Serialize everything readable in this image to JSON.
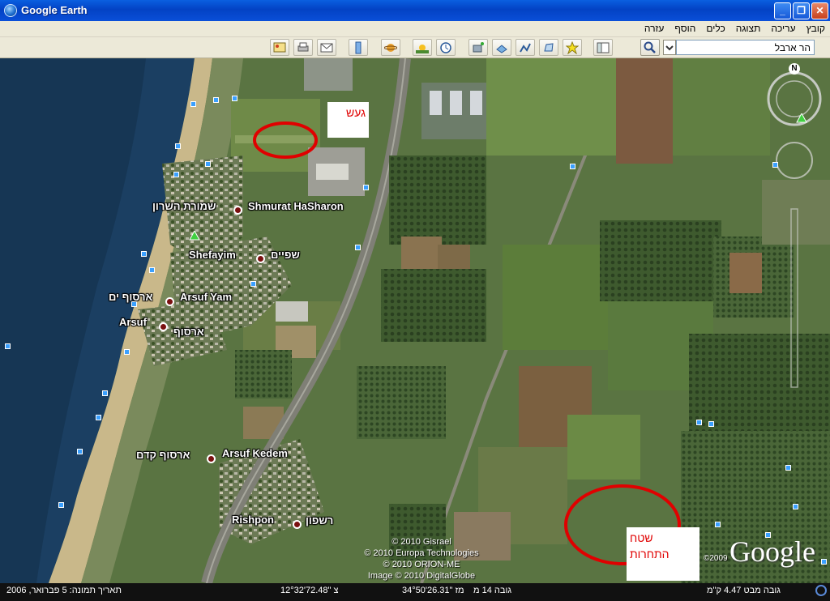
{
  "window": {
    "title": "Google Earth"
  },
  "menu": {
    "items": [
      "קובץ",
      "עריכה",
      "תצוגה",
      "כלים",
      "הוסף",
      "עזרה"
    ]
  },
  "search": {
    "value": "הר ארבל"
  },
  "places": {
    "shmurat_he": "שמורת השרון",
    "shmurat_en": "Shmurat HaSharon",
    "shefayim_en": "Shefayim",
    "shefayim_he": "שפיים",
    "arsufyam_he": "ארסוף ים",
    "arsufyam_en": "Arsuf Yam",
    "arsuf_en": "Arsuf",
    "arsuf_he": "ארסוף",
    "arsufkedem_he": "ארסוף קדם",
    "arsufkedem_en": "Arsuf Kedem",
    "rishpon_en": "Rishpon",
    "rishpon_he": "רשפון"
  },
  "annotations": {
    "top": "געש",
    "bottom_line1": "שטח",
    "bottom_line2": "התחרות"
  },
  "attribution": {
    "line1": "© 2010 Gisrael",
    "line2": "© 2010 Europa Technologies",
    "line3": "© 2010 ORION-ME",
    "line4": "Image © 2010 DigitalGlobe"
  },
  "brand": {
    "name": "Google",
    "year": "©2009"
  },
  "status": {
    "date": "תאריך תמונה: 5 פברואר, 2006",
    "lat": "12°32'72.48\" צ",
    "lon": "34°50'26.31\" מז",
    "elev": "גובה  14 מ",
    "eye": "גובה מבט  4.47 ק\"מ"
  },
  "colors": {
    "sea": "#1b3f62",
    "titlebar": "#0a4fd8",
    "annotation": "#e00000"
  }
}
